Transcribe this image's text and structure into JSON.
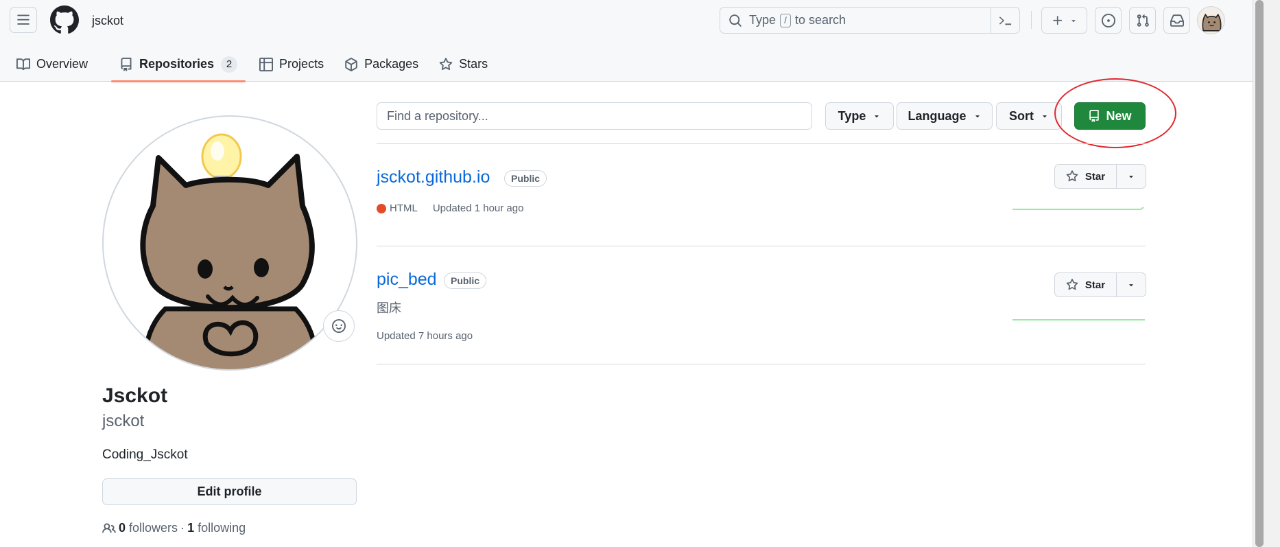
{
  "header": {
    "username": "jsckot",
    "search_prefix": "Type",
    "search_key": "/",
    "search_suffix": "to search"
  },
  "tabs": [
    {
      "label": "Overview"
    },
    {
      "label": "Repositories",
      "count": "2"
    },
    {
      "label": "Projects"
    },
    {
      "label": "Packages"
    },
    {
      "label": "Stars"
    }
  ],
  "profile": {
    "fullname": "Jsckot",
    "login": "jsckot",
    "bio": "Coding_Jsckot",
    "edit_label": "Edit profile",
    "followers_count": "0",
    "followers_label": "followers",
    "separator": "·",
    "following_count": "1",
    "following_label": "following"
  },
  "filters": {
    "find_placeholder": "Find a repository...",
    "type_label": "Type",
    "language_label": "Language",
    "sort_label": "Sort",
    "new_label": "New"
  },
  "repos": [
    {
      "name": "jsckot.github.io",
      "visibility": "Public",
      "language": "HTML",
      "language_color": "#e34c26",
      "updated": "Updated 1 hour ago",
      "description": "",
      "star_label": "Star"
    },
    {
      "name": "pic_bed",
      "visibility": "Public",
      "language": "",
      "updated": "Updated 7 hours ago",
      "description": "图床",
      "star_label": "Star"
    }
  ],
  "colors": {
    "accent_tab": "#fd8c73",
    "link": "#0969da",
    "primary_button": "#1f883d",
    "annotation": "#e0282e"
  }
}
